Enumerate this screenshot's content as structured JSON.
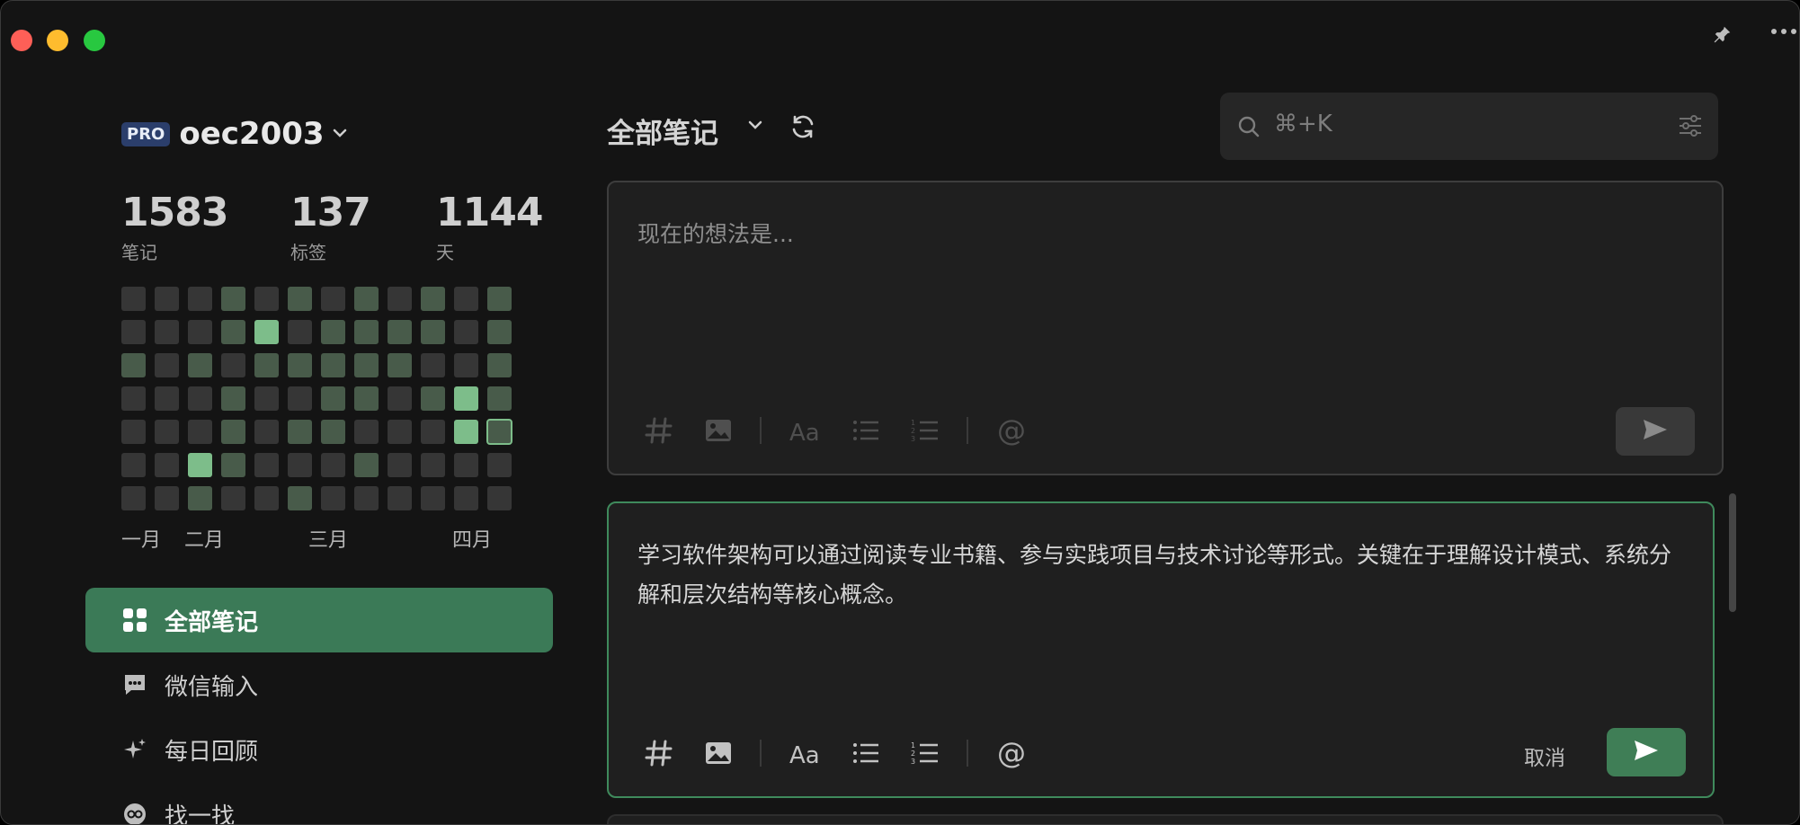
{
  "account": {
    "badge": "PRO",
    "username": "oec2003"
  },
  "stats": [
    {
      "value": "1583",
      "label": "笔记"
    },
    {
      "value": "137",
      "label": "标签"
    },
    {
      "value": "1144",
      "label": "天"
    }
  ],
  "heatmap": {
    "colors": [
      "#363636",
      "#485b4a",
      "#7dbd8a"
    ],
    "rows": [
      [
        0,
        0,
        0,
        1,
        0,
        1,
        0,
        1,
        0,
        1,
        0,
        1
      ],
      [
        0,
        0,
        0,
        1,
        2,
        0,
        1,
        1,
        1,
        1,
        0,
        1
      ],
      [
        1,
        0,
        1,
        0,
        1,
        1,
        1,
        1,
        1,
        0,
        0,
        1
      ],
      [
        0,
        0,
        0,
        1,
        0,
        0,
        1,
        1,
        0,
        1,
        2,
        1
      ],
      [
        0,
        0,
        0,
        1,
        0,
        1,
        1,
        0,
        0,
        0,
        2,
        3
      ],
      [
        0,
        0,
        2,
        1,
        0,
        0,
        0,
        1,
        0,
        0,
        0,
        0
      ],
      [
        0,
        0,
        1,
        0,
        0,
        1,
        0,
        0,
        0,
        0,
        0,
        0
      ]
    ]
  },
  "months": [
    "一月",
    "二月",
    "三月",
    "四月"
  ],
  "nav": [
    {
      "label": "全部笔记",
      "icon": "grid-icon",
      "active": true
    },
    {
      "label": "微信输入",
      "icon": "chat-icon",
      "active": false
    },
    {
      "label": "每日回顾",
      "icon": "sparkle-icon",
      "active": false
    },
    {
      "label": "找一找",
      "icon": "explore-icon",
      "active": false
    }
  ],
  "main": {
    "title": "全部笔记",
    "search_placeholder": "⌘+K"
  },
  "editor_new": {
    "placeholder": "现在的想法是..."
  },
  "editor_edit": {
    "content": "学习软件架构可以通过阅读专业书籍、参与实践项目与技术讨论等形式。关键在于理解设计模式、系统分解和层次结构等核心概念。",
    "cancel_label": "取消"
  },
  "colors": {
    "accent": "#3b7a57",
    "send_active": "#3f7e56"
  }
}
